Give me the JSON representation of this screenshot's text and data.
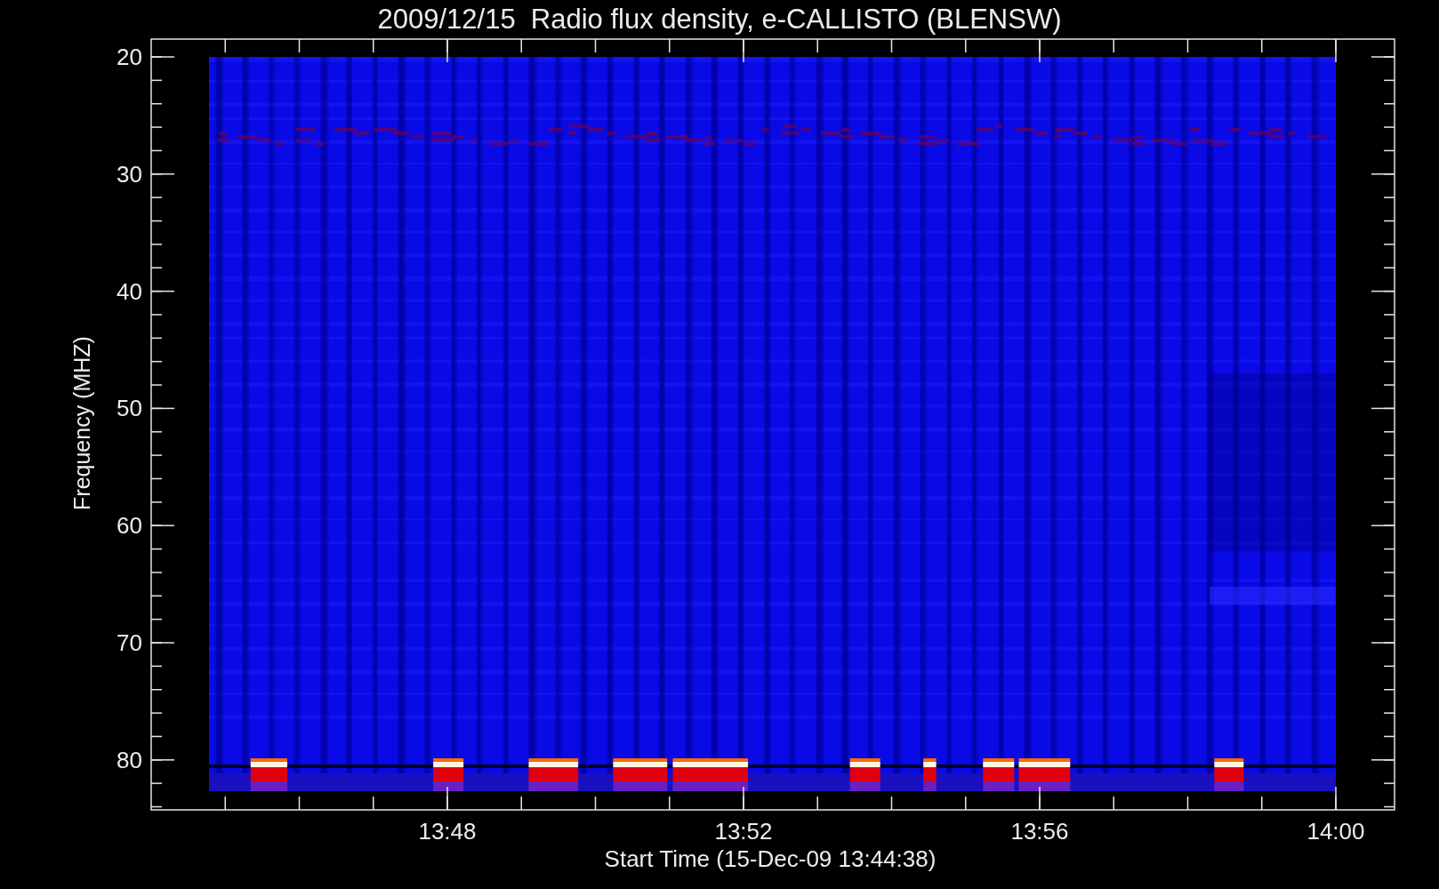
{
  "title": "2009/12/15  Radio flux density, e-CALLISTO (BLENSW)",
  "y_axis": {
    "label": "Frequency (MHZ)",
    "ticks": [
      "20",
      "30",
      "40",
      "50",
      "60",
      "70",
      "80"
    ]
  },
  "x_axis": {
    "label": "Start Time (15-Dec-09 13:44:38)",
    "ticks": [
      "13:48",
      "13:52",
      "13:56",
      "14:00"
    ]
  }
}
